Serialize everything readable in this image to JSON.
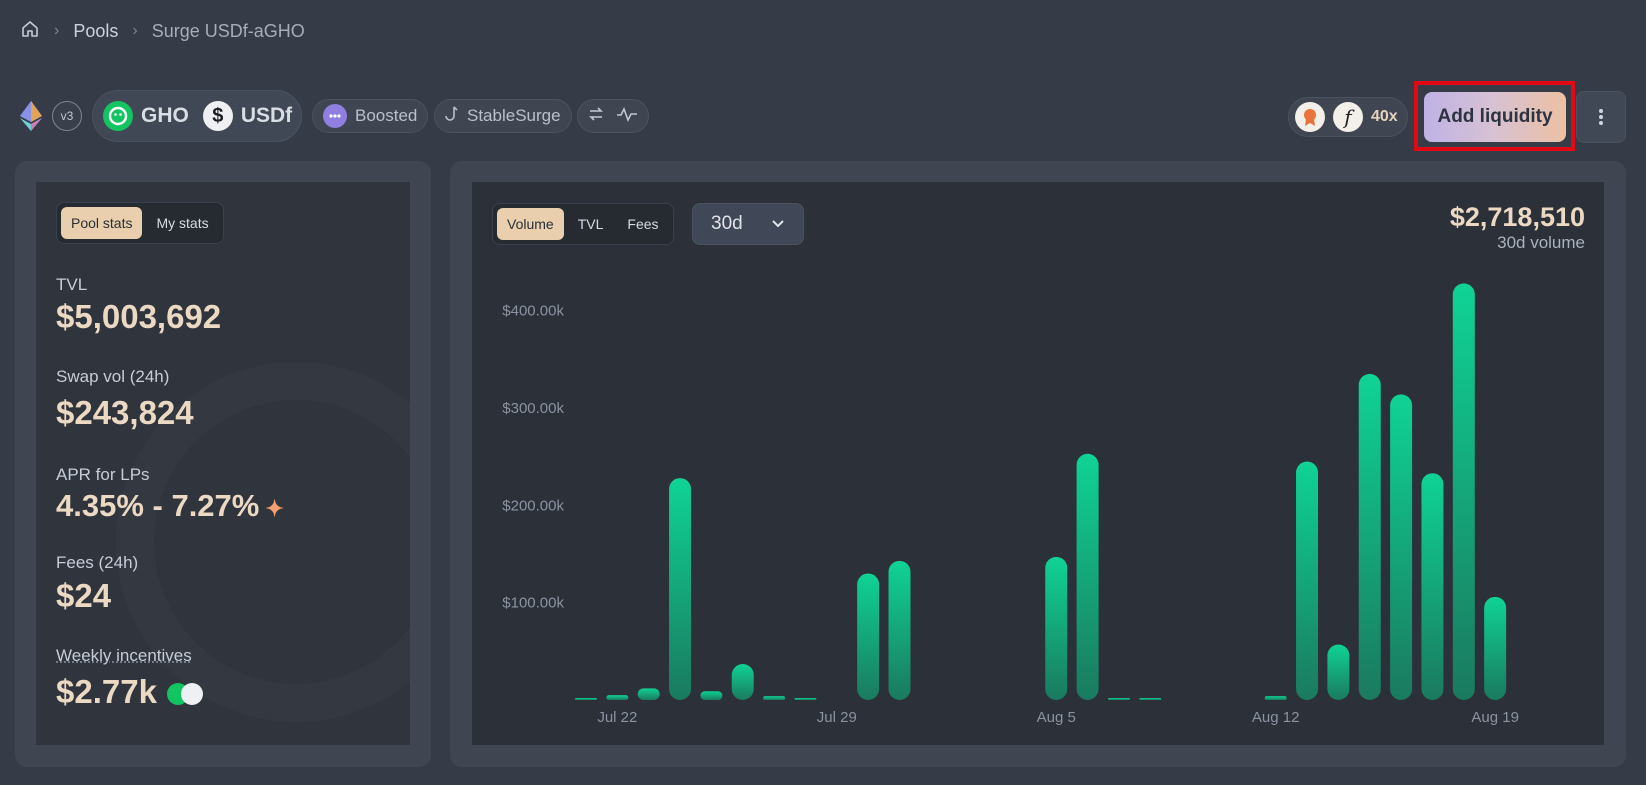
{
  "breadcrumb": {
    "home_icon": "home-icon",
    "items": [
      "Pools",
      "Surge USDf-aGHO"
    ]
  },
  "header": {
    "version": "v3",
    "tokens": [
      {
        "symbol": "GHO",
        "icon": "gho-icon",
        "color": "#13c463"
      },
      {
        "symbol": "USDf",
        "icon": "usdf-icon"
      }
    ],
    "tags": [
      "Boosted",
      "StableSurge"
    ],
    "points_multiplier": "40x",
    "add_liquidity_label": "Add liquidity",
    "more_icon": "more-vertical-icon",
    "accent_gradient": [
      "#bfb3e6",
      "#ecc0a3"
    ]
  },
  "stats_panel": {
    "tabs": [
      "Pool stats",
      "My stats"
    ],
    "active_tab": "Pool stats",
    "stats": [
      {
        "label": "TVL",
        "value": "$5,003,692"
      },
      {
        "label": "Swap vol (24h)",
        "value": "$243,824"
      },
      {
        "label": "APR for LPs",
        "value": "4.35% - 7.27%"
      },
      {
        "label": "Fees (24h)",
        "value": "$24"
      },
      {
        "label": "Weekly incentives",
        "value": "$2.77k"
      }
    ]
  },
  "chart_panel": {
    "tabs": [
      "Volume",
      "TVL",
      "Fees"
    ],
    "active_tab": "Volume",
    "period": "30d",
    "total_value": "$2,718,510",
    "total_label": "30d volume"
  },
  "chart_data": {
    "type": "bar",
    "bar_color": "#10c98c",
    "ylim": [
      0,
      450000
    ],
    "y_ticks": [
      {
        "value": 100000,
        "label": "$100.00k"
      },
      {
        "value": 200000,
        "label": "$200.00k"
      },
      {
        "value": 300000,
        "label": "$300.00k"
      },
      {
        "value": 400000,
        "label": "$400.00k"
      }
    ],
    "x_ticks": [
      {
        "index": 1,
        "label": "Jul 22"
      },
      {
        "index": 8,
        "label": "Jul 29"
      },
      {
        "index": 15,
        "label": "Aug 5"
      },
      {
        "index": 22,
        "label": "Aug 12"
      },
      {
        "index": 29,
        "label": "Aug 19"
      }
    ],
    "categories": [
      "Jul 21",
      "Jul 22",
      "Jul 23",
      "Jul 24",
      "Jul 25",
      "Jul 26",
      "Jul 27",
      "Jul 28",
      "Jul 29",
      "Jul 30",
      "Jul 31",
      "Aug 1",
      "Aug 2",
      "Aug 3",
      "Aug 4",
      "Aug 5",
      "Aug 6",
      "Aug 7",
      "Aug 8",
      "Aug 9",
      "Aug 10",
      "Aug 11",
      "Aug 12",
      "Aug 13",
      "Aug 14",
      "Aug 15",
      "Aug 16",
      "Aug 17",
      "Aug 18",
      "Aug 19",
      "Aug 20"
    ],
    "values": [
      1500,
      5000,
      12000,
      228000,
      9000,
      37000,
      4000,
      500,
      0,
      130000,
      143000,
      0,
      0,
      0,
      0,
      147000,
      253000,
      1000,
      1000,
      0,
      0,
      0,
      4000,
      245000,
      57000,
      335000,
      314000,
      233000,
      428000,
      106000,
      0
    ]
  }
}
